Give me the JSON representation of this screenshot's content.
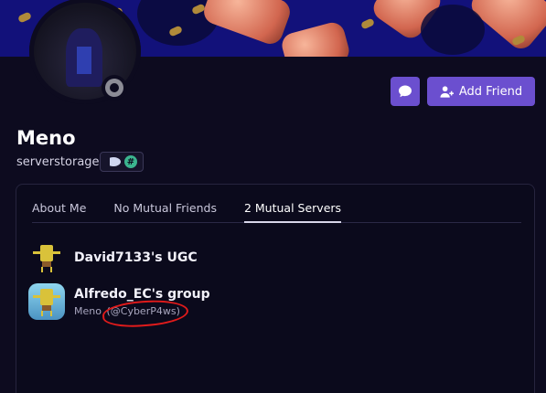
{
  "profile": {
    "display_name": "Meno",
    "username": "serverstorage",
    "status": "offline",
    "badge_icons": [
      "speed-badge-icon",
      "hashtag-badge-icon"
    ]
  },
  "actions": {
    "message_icon": "chat-bubble-icon",
    "add_friend_label": "Add Friend",
    "add_friend_icon": "add-user-icon"
  },
  "tabs": [
    {
      "label": "About Me",
      "active": false
    },
    {
      "label": "No Mutual Friends",
      "active": false
    },
    {
      "label": "2 Mutual Servers",
      "active": true
    }
  ],
  "servers": [
    {
      "name": "David7133's UGC",
      "nickname": "",
      "handle": ""
    },
    {
      "name": "Alfredo_EC's group",
      "nickname": "Meno",
      "handle": "(@CyberP4ws)"
    }
  ],
  "colors": {
    "accent": "#6b4fcf",
    "background": "#0d0b1f",
    "banner": "#12117a",
    "annotation": "#e01b1b"
  }
}
